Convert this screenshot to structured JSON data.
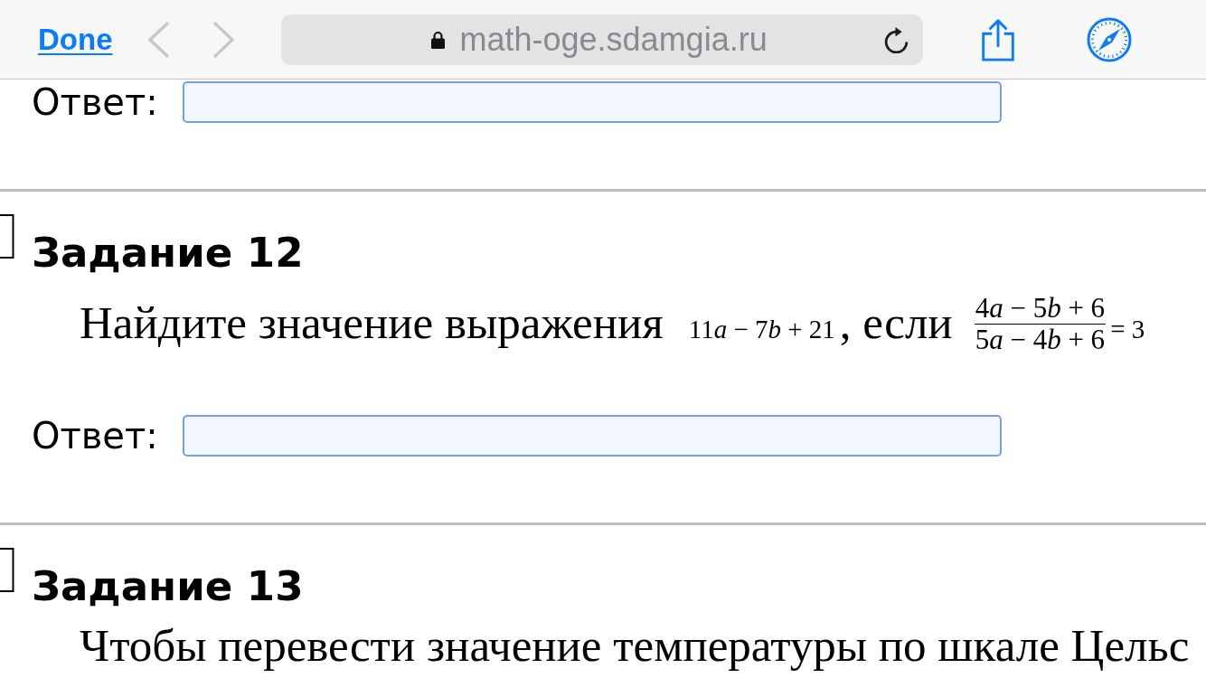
{
  "toolbar": {
    "done": "Done",
    "back": {
      "disabled": true
    },
    "forward": {
      "disabled": true
    },
    "address": "math-oge.sdamgia.ru"
  },
  "sections": [
    {
      "answer_label": "Ответ:"
    },
    {
      "title": "Задание 12",
      "statement": [
        {
          "kind": "text",
          "text": "Найдите значение выражения"
        },
        {
          "kind": "math",
          "text": "11a − 7b + 21"
        },
        {
          "kind": "text",
          "text": ", если"
        },
        {
          "kind": "fraction",
          "numerator": "4a − 5b + 6",
          "denominator": "5a − 4b + 6"
        },
        {
          "kind": "math",
          "text": "= 3"
        }
      ],
      "answer_label": "Ответ:"
    },
    {
      "title": "Задание 13",
      "statement": [
        {
          "kind": "text",
          "text": "Чтобы перевести значение температуры по шкале Цельс"
        }
      ]
    }
  ]
}
